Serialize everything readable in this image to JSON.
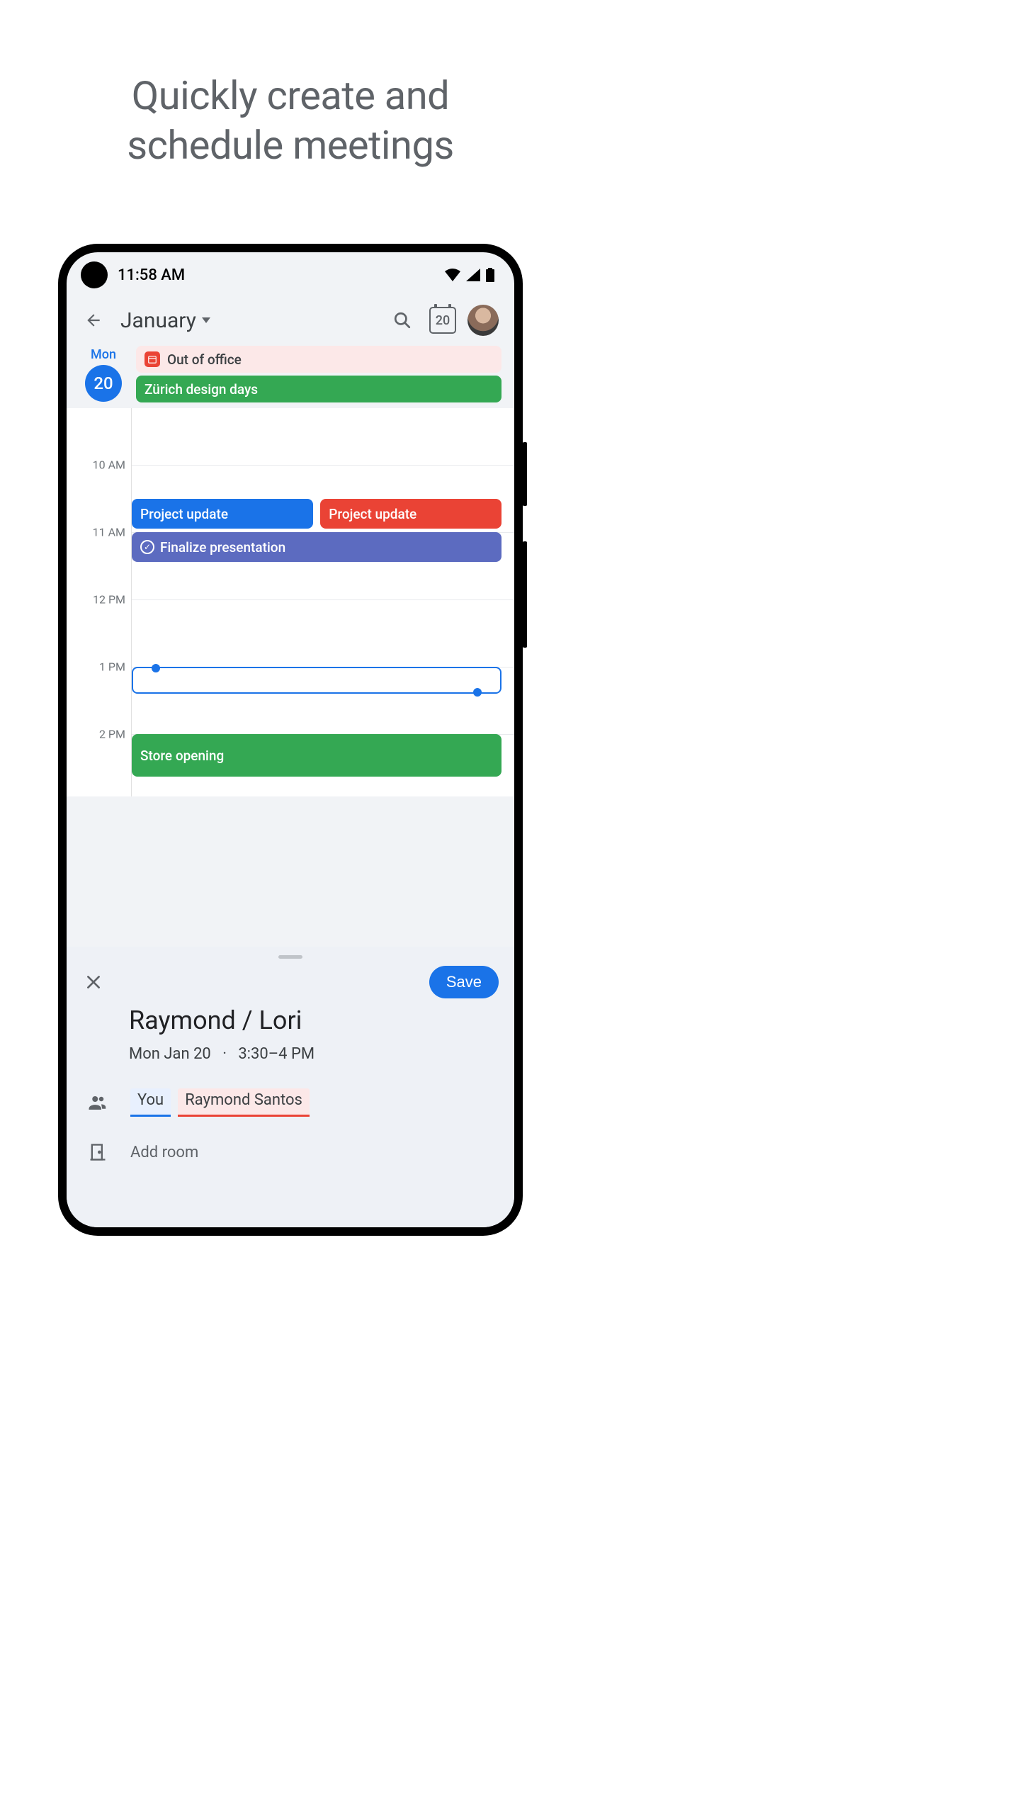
{
  "marketing": {
    "headline_line1": "Quickly create and",
    "headline_line2": "schedule meetings"
  },
  "status": {
    "time": "11:58 AM"
  },
  "header": {
    "month": "January",
    "today_date": "20"
  },
  "day": {
    "weekday": "Mon",
    "date": "20",
    "allday": {
      "out_of_office": "Out of office",
      "zurich": "Zürich design days"
    }
  },
  "time_labels": {
    "t10": "10 AM",
    "t11": "11 AM",
    "t12": "12 PM",
    "t13": "1 PM",
    "t14": "2 PM"
  },
  "events": {
    "project_update_a": "Project update",
    "project_update_b": "Project update",
    "finalize": "Finalize presentation",
    "store_opening": "Store opening"
  },
  "panel": {
    "save_label": "Save",
    "title": "Raymond / Lori",
    "date": "Mon Jan 20",
    "dot": "·",
    "time_range": "3:30–4 PM",
    "you_chip": "You",
    "guest_chip": "Raymond Santos",
    "add_room": "Add room"
  }
}
